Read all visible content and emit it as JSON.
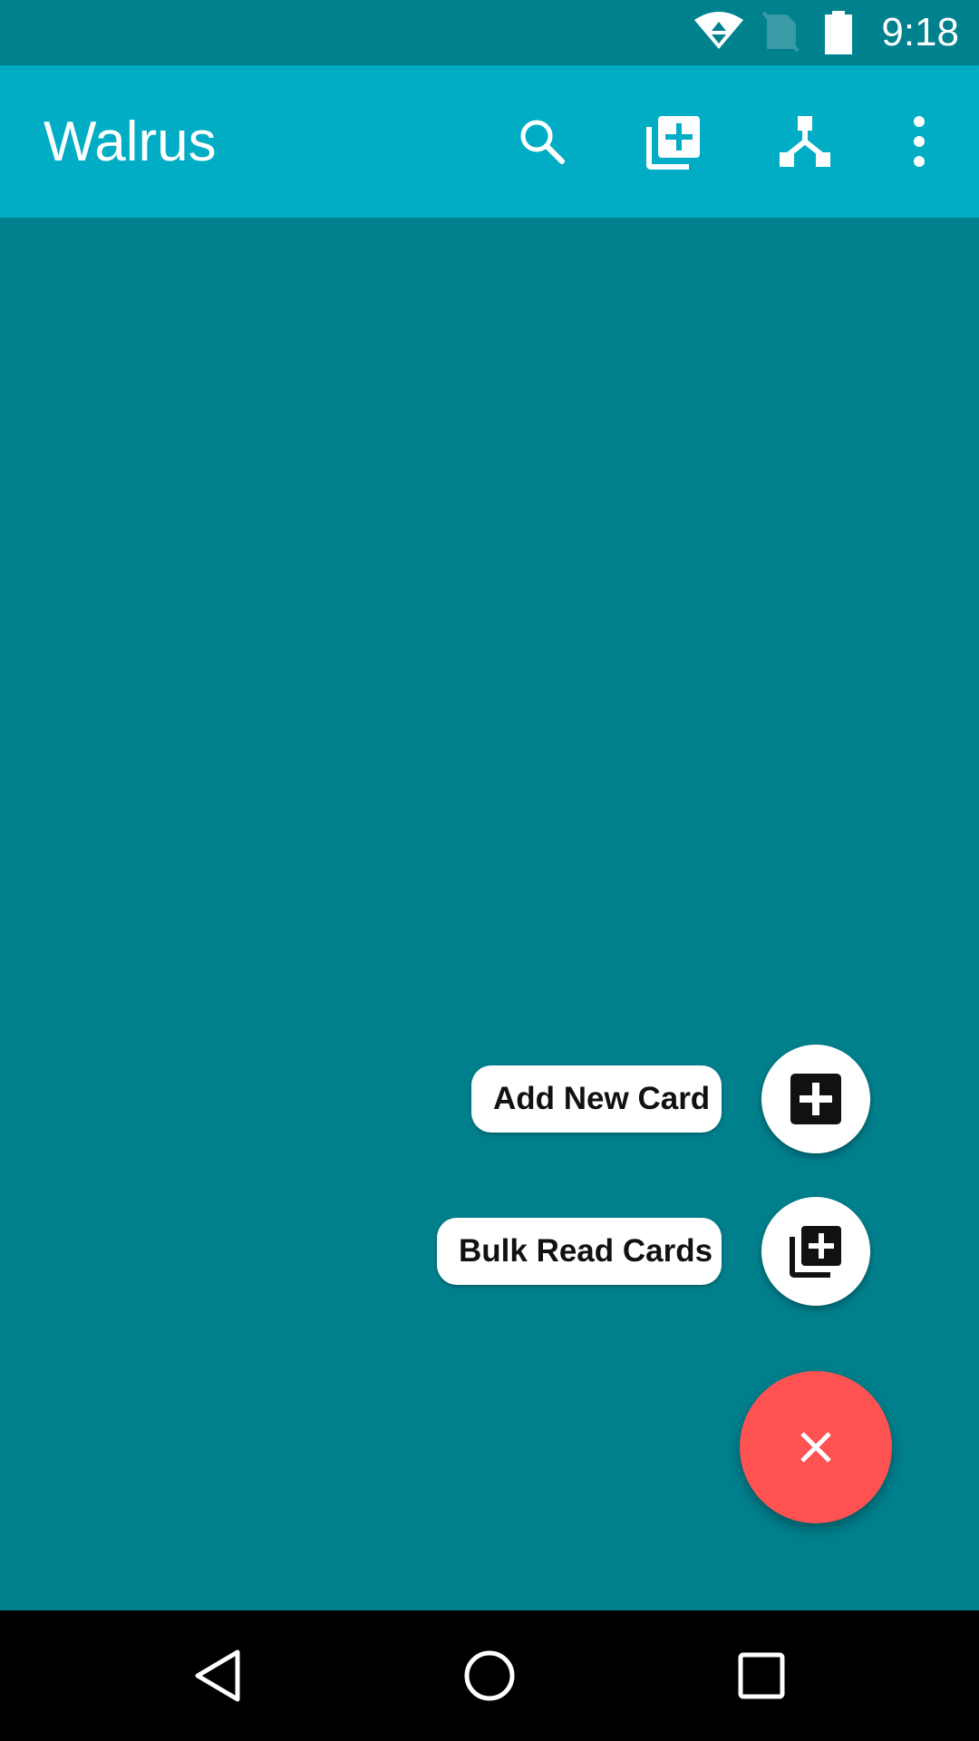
{
  "status_bar": {
    "time": "9:18",
    "icons": [
      "wifi-icon",
      "no-sim-icon",
      "battery-icon"
    ]
  },
  "app_bar": {
    "title": "Walrus",
    "actions": [
      "search-icon",
      "bulk-add-icon",
      "share-icon",
      "more-vert-icon"
    ]
  },
  "fab_menu": {
    "add_card_label": "Add New Card",
    "add_card_icon": "add-box-icon",
    "bulk_read_label": "Bulk Read Cards",
    "bulk_read_icon": "library-add-icon",
    "close_icon": "close-icon"
  },
  "nav_bar": {
    "buttons": [
      "back-icon",
      "home-icon",
      "recents-icon"
    ]
  },
  "colors": {
    "background": "#007f8c",
    "status_bar": "#00818e",
    "app_bar": "#00adc4",
    "fab": "#ff5252",
    "mini_fab": "#ffffff"
  }
}
